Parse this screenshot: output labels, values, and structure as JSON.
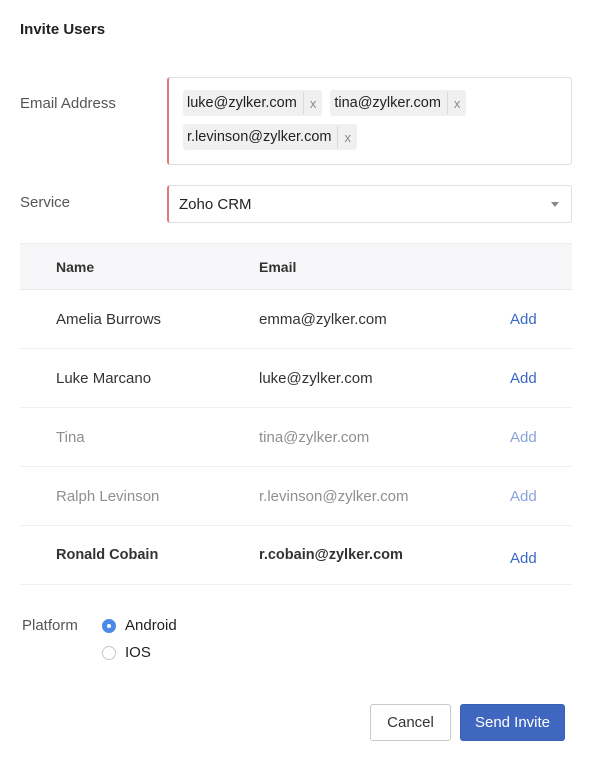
{
  "dialog": {
    "title": "Invite Users"
  },
  "form": {
    "email_label": "Email Address",
    "email_chips": [
      {
        "email": "luke@zylker.com",
        "remove": "x"
      },
      {
        "email": "tina@zylker.com",
        "remove": "x"
      },
      {
        "email": "r.levinson@zylker.com",
        "remove": "x"
      }
    ],
    "service_label": "Service",
    "service_value": "Zoho CRM"
  },
  "table": {
    "headers": {
      "name": "Name",
      "email": "Email"
    },
    "rows": [
      {
        "name": "Amelia Burrows",
        "email": "emma@zylker.com",
        "action": "Add",
        "state": "normal"
      },
      {
        "name": "Luke Marcano",
        "email": "luke@zylker.com",
        "action": "Add",
        "state": "normal"
      },
      {
        "name": "Tina",
        "email": "tina@zylker.com",
        "action": "Add",
        "state": "muted"
      },
      {
        "name": "Ralph Levinson",
        "email": "r.levinson@zylker.com",
        "action": "Add",
        "state": "muted"
      },
      {
        "name": "Ronald Cobain",
        "email": "r.cobain@zylker.com",
        "action": "Add",
        "state": "bold"
      }
    ]
  },
  "platform": {
    "label": "Platform",
    "options": [
      {
        "label": "Android",
        "checked": true
      },
      {
        "label": "IOS",
        "checked": false
      }
    ]
  },
  "footer": {
    "cancel_label": "Cancel",
    "send_label": "Send Invite"
  },
  "colors": {
    "accent": "#3f67c0",
    "link": "#3b67c7",
    "required_border": "#e07b7b",
    "radio_checked": "#4a8ae6"
  }
}
